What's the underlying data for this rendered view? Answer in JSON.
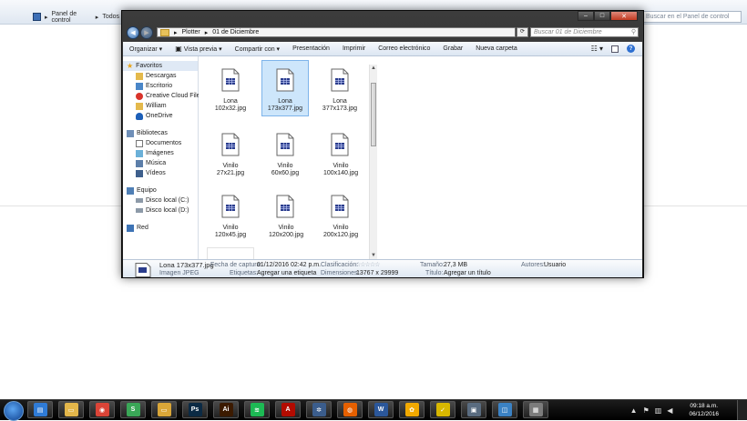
{
  "background_window": {
    "breadcrumb": [
      "Panel de control",
      "Todos"
    ],
    "search_placeholder": "Buscar en el Panel de control"
  },
  "window": {
    "address_path": [
      "Plotter",
      "01 de Diciembre"
    ],
    "search_placeholder": "Buscar 01 de Diciembre",
    "caption_buttons": {
      "minimize": "–",
      "maximize": "□",
      "close": "✕"
    }
  },
  "toolbar": {
    "organize": "Organizar",
    "preview": "Vista previa",
    "share": "Compartir con",
    "slideshow": "Presentación",
    "print": "Imprimir",
    "email": "Correo electrónico",
    "burn": "Grabar",
    "new_folder": "Nueva carpeta"
  },
  "nav": {
    "favorites": {
      "label": "Favoritos",
      "items": [
        "Descargas",
        "Escritorio",
        "Creative Cloud Files",
        "William",
        "OneDrive"
      ]
    },
    "libraries": {
      "label": "Bibliotecas",
      "items": [
        "Documentos",
        "Imágenes",
        "Música",
        "Vídeos"
      ]
    },
    "computer": {
      "label": "Equipo",
      "items": [
        "Disco local (C:)",
        "Disco local (D:)"
      ]
    },
    "network": {
      "label": "Red"
    }
  },
  "files": [
    "Lona 102x32.jpg",
    "Lona 173x377.jpg",
    "Lona 377x173.jpg",
    "Vinilo 27x21.jpg",
    "Vinilo 60x60.jpg",
    "Vinilo 100x140.jpg",
    "Vinilo 120x45.jpg",
    "Vinilo 120x200.jpg",
    "Vinilo 200x120.jpg"
  ],
  "details": {
    "filename": "Lona 173x377.jpg",
    "filetype": "Imagen JPEG",
    "capture_label": "Fecha de captura:",
    "capture_value": "01/12/2016 02:42 p.m.",
    "tags_label": "Etiquetas:",
    "tags_value": "Agregar una etiqueta",
    "rating_label": "Clasificación:",
    "rating_stars": "☆☆☆☆☆",
    "dimensions_label": "Dimensiones:",
    "dimensions_value": "13767 x 29999",
    "size_label": "Tamaño:",
    "size_value": "27,3 MB",
    "title_label": "Título:",
    "title_value": "Agregar un título",
    "authors_label": "Autores:",
    "authors_value": "Usuario"
  },
  "taskbar": {
    "time": "09:18 a.m.",
    "date": "06/12/2016",
    "apps": [
      {
        "name": "task-manager",
        "glyph": "▤",
        "color": "#2f7bd6"
      },
      {
        "name": "explorer",
        "glyph": "▭",
        "color": "#e3b64a"
      },
      {
        "name": "chrome",
        "glyph": "◉",
        "color": "#db4437"
      },
      {
        "name": "app-green",
        "glyph": "S",
        "color": "#3aa757"
      },
      {
        "name": "folder",
        "glyph": "▭",
        "color": "#d9a638"
      },
      {
        "name": "photoshop",
        "glyph": "Ps",
        "color": "#0b2a44"
      },
      {
        "name": "illustrator",
        "glyph": "Ai",
        "color": "#3b1a00"
      },
      {
        "name": "spotify",
        "glyph": "≋",
        "color": "#1db954"
      },
      {
        "name": "acrobat",
        "glyph": "A",
        "color": "#b30b00"
      },
      {
        "name": "settings",
        "glyph": "✲",
        "color": "#3b5d8c"
      },
      {
        "name": "firefox",
        "glyph": "◍",
        "color": "#e66000"
      },
      {
        "name": "word",
        "glyph": "W",
        "color": "#2b579a"
      },
      {
        "name": "tool-yellow",
        "glyph": "✿",
        "color": "#f2a900"
      },
      {
        "name": "norton",
        "glyph": "✓",
        "color": "#d8b700"
      },
      {
        "name": "window-app",
        "glyph": "▣",
        "color": "#5a6c80"
      },
      {
        "name": "remote-desktop",
        "glyph": "◫",
        "color": "#3b82c4"
      },
      {
        "name": "gallery",
        "glyph": "▦",
        "color": "#7c7c7c"
      }
    ]
  }
}
